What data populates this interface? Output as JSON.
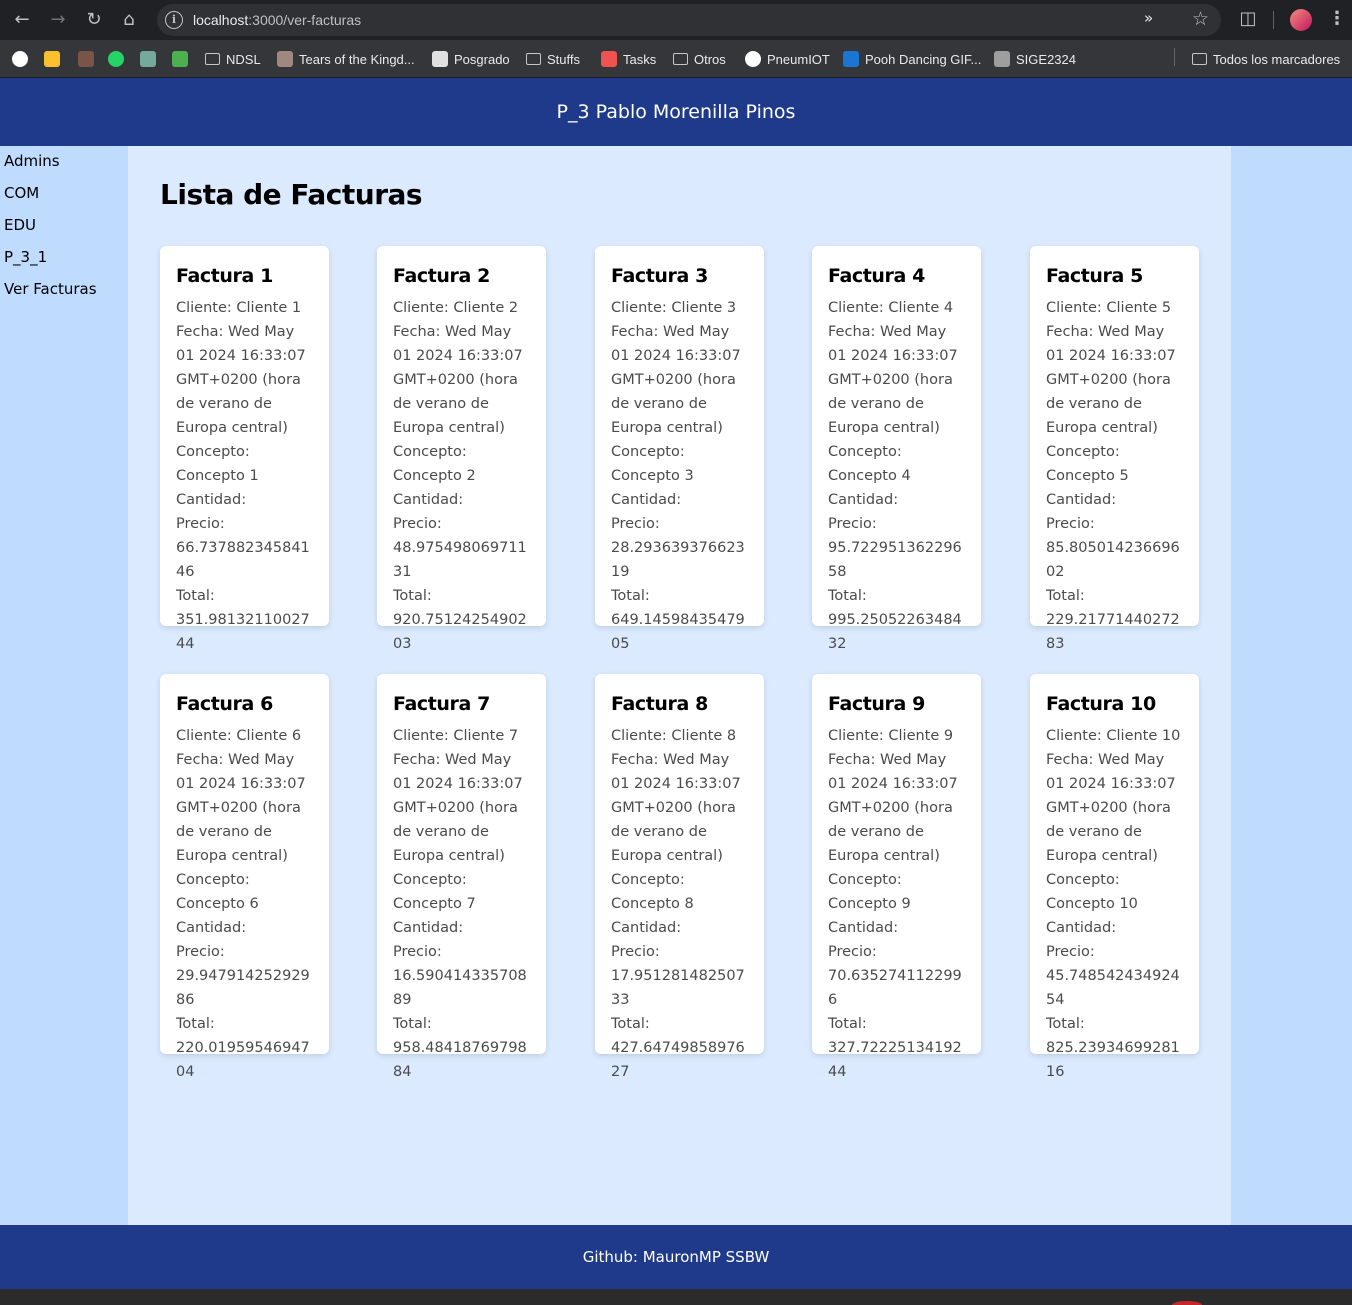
{
  "browser": {
    "url_host": "localhost",
    "url_path": ":3000/ver-facturas",
    "bookmarks": [
      {
        "label": "",
        "icon": "google-icon",
        "color": "#ffffff"
      },
      {
        "label": "",
        "icon": "arrow-app-icon",
        "color": "#fbc02d"
      },
      {
        "label": "",
        "icon": "penguin-icon",
        "color": "#795548"
      },
      {
        "label": "",
        "icon": "whatsapp-icon",
        "color": "#25d366"
      },
      {
        "label": "",
        "icon": "chatgpt-icon",
        "color": "#74aa9c"
      },
      {
        "label": "",
        "icon": "leaf-icon",
        "color": "#4caf50"
      },
      {
        "label": "NDSL",
        "icon": "folder-icon"
      },
      {
        "label": "Tears of the Kingd...",
        "icon": "zelda-icon",
        "color": "#a1887f"
      },
      {
        "label": "Posgrado",
        "icon": "posgrado-icon",
        "color": "#e0e0e0"
      },
      {
        "label": "Stuffs",
        "icon": "folder-icon"
      },
      {
        "label": "Tasks",
        "icon": "tasks-icon",
        "color": "#ef5350"
      },
      {
        "label": "Otros",
        "icon": "folder-icon"
      },
      {
        "label": "PneumIOT",
        "icon": "github-icon",
        "color": "#ffffff"
      },
      {
        "label": "Pooh Dancing GIF...",
        "icon": "gif-icon",
        "color": "#1976d2"
      },
      {
        "label": "SIGE2324",
        "icon": "classroom-icon",
        "color": "#9e9e9e"
      }
    ],
    "all_bookmarks": "Todos los marcadores"
  },
  "header": {
    "title": "P_3 Pablo Morenilla Pinos"
  },
  "sidebar": {
    "items": [
      {
        "label": "Admins"
      },
      {
        "label": "COM"
      },
      {
        "label": "EDU"
      },
      {
        "label": "P_3_1"
      },
      {
        "label": "Ver Facturas"
      }
    ]
  },
  "main": {
    "title": "Lista de Facturas",
    "facturas": [
      {
        "title": "Factura 1",
        "cliente": "Cliente: Cliente 1",
        "fecha": "Fecha: Wed May 01 2024 16:33:07 GMT+0200 (hora de verano de Europa central)",
        "concepto": "Concepto: Concepto 1",
        "cantidad": "Cantidad:",
        "precio": "Precio: 66.73788234584146",
        "total": "Total: 351.9813211002744"
      },
      {
        "title": "Factura 2",
        "cliente": "Cliente: Cliente 2",
        "fecha": "Fecha: Wed May 01 2024 16:33:07 GMT+0200 (hora de verano de Europa central)",
        "concepto": "Concepto: Concepto 2",
        "cantidad": "Cantidad:",
        "precio": "Precio: 48.97549806971131",
        "total": "Total: 920.7512425490203"
      },
      {
        "title": "Factura 3",
        "cliente": "Cliente: Cliente 3",
        "fecha": "Fecha: Wed May 01 2024 16:33:07 GMT+0200 (hora de verano de Europa central)",
        "concepto": "Concepto: Concepto 3",
        "cantidad": "Cantidad:",
        "precio": "Precio: 28.29363937662319",
        "total": "Total: 649.1459843547905"
      },
      {
        "title": "Factura 4",
        "cliente": "Cliente: Cliente 4",
        "fecha": "Fecha: Wed May 01 2024 16:33:07 GMT+0200 (hora de verano de Europa central)",
        "concepto": "Concepto: Concepto 4",
        "cantidad": "Cantidad:",
        "precio": "Precio: 95.72295136229658",
        "total": "Total: 995.2505226348432"
      },
      {
        "title": "Factura 5",
        "cliente": "Cliente: Cliente 5",
        "fecha": "Fecha: Wed May 01 2024 16:33:07 GMT+0200 (hora de verano de Europa central)",
        "concepto": "Concepto: Concepto 5",
        "cantidad": "Cantidad:",
        "precio": "Precio: 85.80501423669602",
        "total": "Total: 229.2177144027283"
      },
      {
        "title": "Factura 6",
        "cliente": "Cliente: Cliente 6",
        "fecha": "Fecha: Wed May 01 2024 16:33:07 GMT+0200 (hora de verano de Europa central)",
        "concepto": "Concepto: Concepto 6",
        "cantidad": "Cantidad:",
        "precio": "Precio: 29.94791425292986",
        "total": "Total: 220.0195954694704"
      },
      {
        "title": "Factura 7",
        "cliente": "Cliente: Cliente 7",
        "fecha": "Fecha: Wed May 01 2024 16:33:07 GMT+0200 (hora de verano de Europa central)",
        "concepto": "Concepto: Concepto 7",
        "cantidad": "Cantidad:",
        "precio": "Precio: 16.59041433570889",
        "total": "Total: 958.4841876979884"
      },
      {
        "title": "Factura 8",
        "cliente": "Cliente: Cliente 8",
        "fecha": "Fecha: Wed May 01 2024 16:33:07 GMT+0200 (hora de verano de Europa central)",
        "concepto": "Concepto: Concepto 8",
        "cantidad": "Cantidad:",
        "precio": "Precio: 17.95128148250733",
        "total": "Total: 427.6474985897627"
      },
      {
        "title": "Factura 9",
        "cliente": "Cliente: Cliente 9",
        "fecha": "Fecha: Wed May 01 2024 16:33:07 GMT+0200 (hora de verano de Europa central)",
        "concepto": "Concepto: Concepto 9",
        "cantidad": "Cantidad:",
        "precio": "Precio: 70.6352741122996",
        "total": "Total: 327.7222513419244"
      },
      {
        "title": "Factura 10",
        "cliente": "Cliente: Cliente 10",
        "fecha": "Fecha: Wed May 01 2024 16:33:07 GMT+0200 (hora de verano de Europa central)",
        "concepto": "Concepto: Concepto 10",
        "cantidad": "Cantidad:",
        "precio": "Precio: 45.74854243492454",
        "total": "Total: 825.2393469928116"
      }
    ]
  },
  "footer": {
    "text": "Github: MauronMP SSBW"
  },
  "colors": {
    "header_bg": "#1f3a8a",
    "sidebar_bg": "#bfdbfe",
    "main_bg": "#dbeafe",
    "card_bg": "#ffffff"
  }
}
